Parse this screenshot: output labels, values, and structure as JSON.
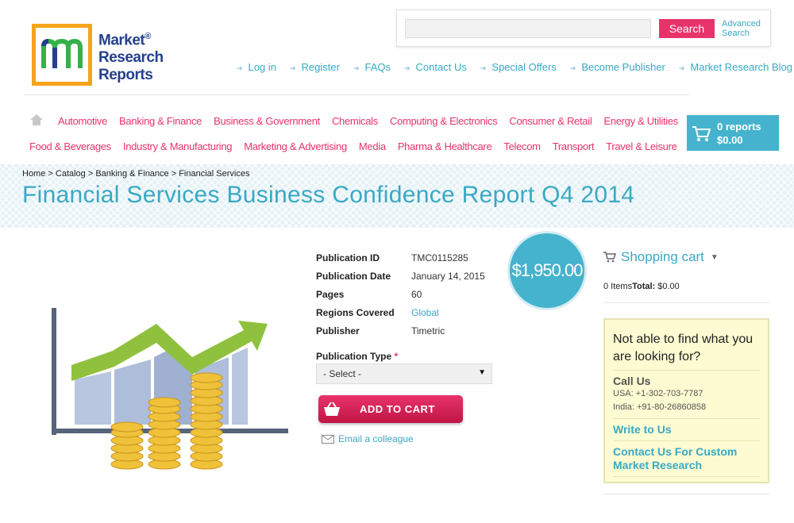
{
  "header": {
    "logo_text_1": "Market",
    "logo_text_2": "Research",
    "logo_text_3": "Reports",
    "logo_mark": "m",
    "search_placeholder": "",
    "search_button": "Search",
    "advanced_search_1": "Advanced",
    "advanced_search_2": "Search",
    "top_links": [
      "Log in",
      "Register",
      "FAQs",
      "Contact Us",
      "Special Offers",
      "Become Publisher",
      "Market Research Blog"
    ]
  },
  "nav": {
    "row1": [
      "Automotive",
      "Banking & Finance",
      "Business & Government",
      "Chemicals",
      "Computing & Electronics",
      "Consumer & Retail",
      "Energy & Utilities"
    ],
    "row2": [
      "Food & Beverages",
      "Industry & Manufacturing",
      "Marketing & Advertising",
      "Media",
      "Pharma & Healthcare",
      "Telecom",
      "Transport",
      "Travel & Leisure"
    ]
  },
  "cart": {
    "reports": "0 reports",
    "total": "$0.00"
  },
  "breadcrumb": "Home > Catalog > Banking & Finance > Financial Services",
  "title": "Financial Services Business Confidence Report Q4 2014",
  "product": {
    "details": [
      {
        "label": "Publication ID",
        "value": "TMC0115285",
        "link": false
      },
      {
        "label": "Publication Date",
        "value": "January 14, 2015",
        "link": false
      },
      {
        "label": "Pages",
        "value": "60",
        "link": false
      },
      {
        "label": "Regions Covered",
        "value": "Global",
        "link": true
      },
      {
        "label": "Publisher",
        "value": "Timetric",
        "link": false
      }
    ],
    "price": "$1,950.00",
    "pub_type_label": "Publication Type",
    "pub_type_required": "*",
    "pub_type_selected": "- Select -",
    "add_to_cart": "ADD TO CART",
    "email_colleague": "Email a colleague"
  },
  "sidebar": {
    "cart_title": "Shopping cart",
    "items_text": "0 Items",
    "total_label": "Total:",
    "total_value": "$0.00",
    "help_question": "Not able to find what you are looking for?",
    "call_us": "Call Us",
    "phone_usa": "USA: +1-302-703-7787",
    "phone_india": "India: +91-80-26860858",
    "write_to_us": "Write to Us",
    "contact_custom": "Contact Us For Custom Market Research"
  },
  "colors": {
    "accent_pink": "#e8336a",
    "accent_teal": "#39a9c4",
    "cart_blue": "#45b3cd",
    "logo_orange": "#f6a31c",
    "logo_navy": "#24408f"
  }
}
